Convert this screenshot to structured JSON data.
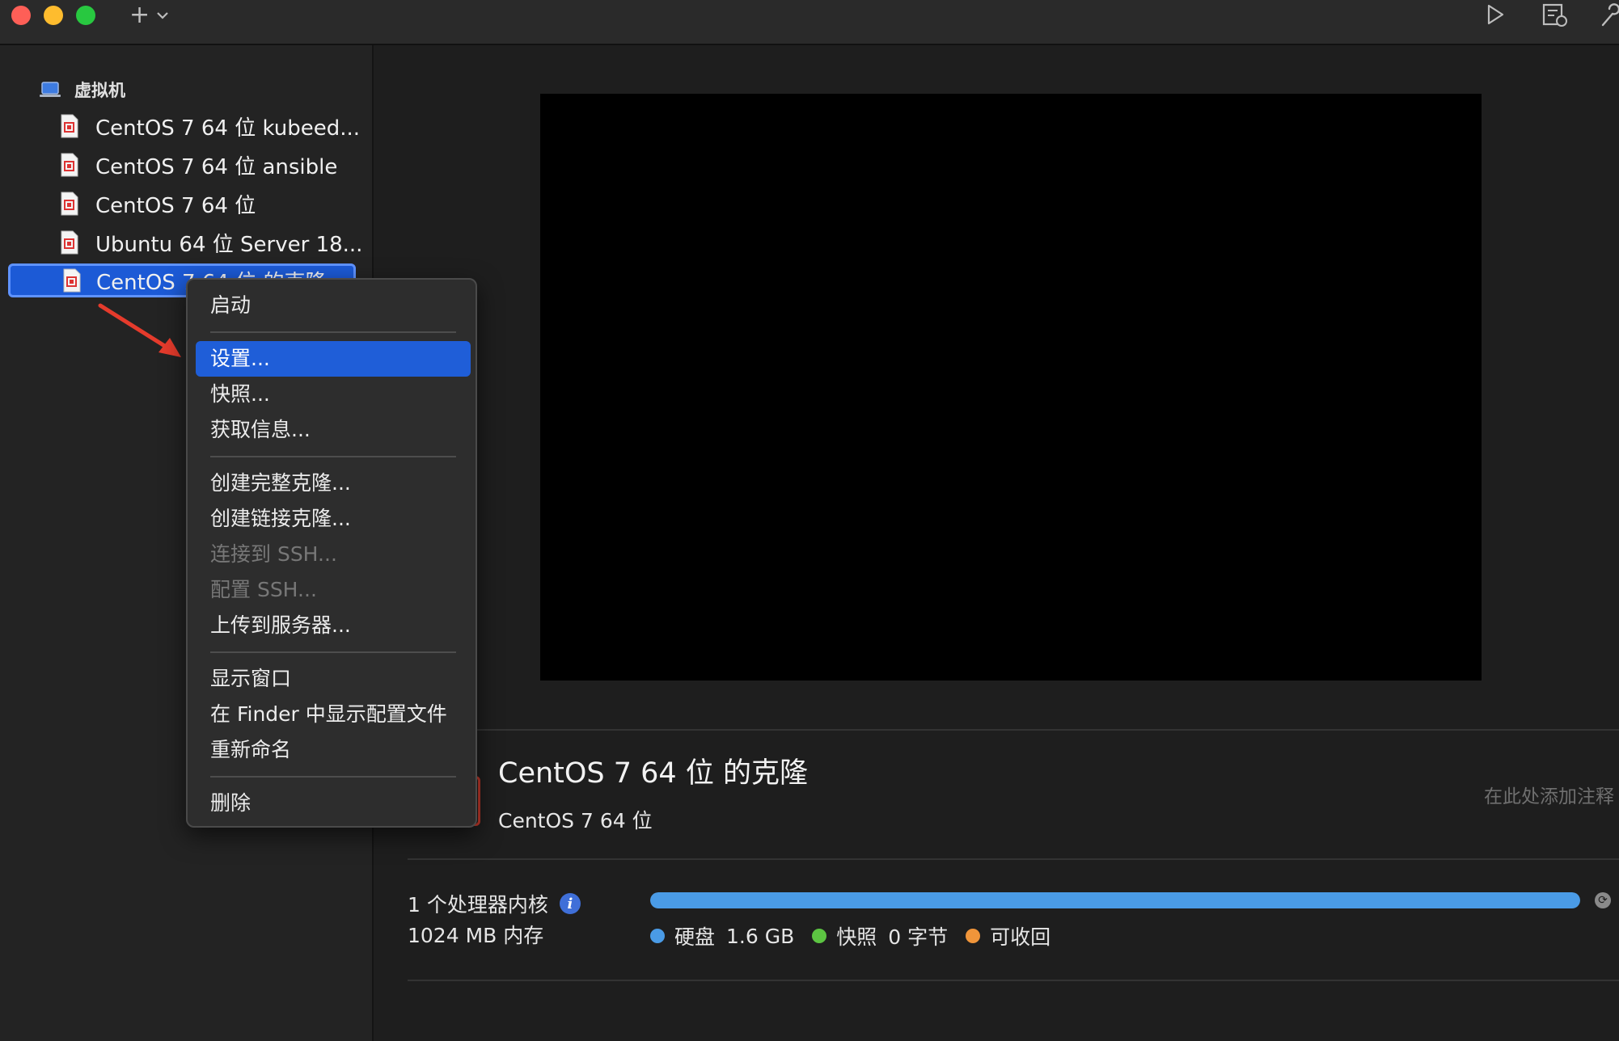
{
  "sidebar": {
    "group_label": "虚拟机",
    "items": [
      {
        "label": "CentOS 7 64 位 kubeed..."
      },
      {
        "label": "CentOS 7 64 位 ansible"
      },
      {
        "label": "CentOS 7 64 位"
      },
      {
        "label": "Ubuntu 64 位 Server 18..."
      },
      {
        "label": "CentOS 7 64 位 的克隆"
      }
    ]
  },
  "context_menu": {
    "items": [
      {
        "label": "启动"
      },
      {
        "label": "设置..."
      },
      {
        "label": "快照..."
      },
      {
        "label": "获取信息..."
      },
      {
        "label": "创建完整克隆..."
      },
      {
        "label": "创建链接克隆..."
      },
      {
        "label": "连接到 SSH..."
      },
      {
        "label": "配置 SSH..."
      },
      {
        "label": "上传到服务器..."
      },
      {
        "label": "显示窗口"
      },
      {
        "label": "在 Finder 中显示配置文件"
      },
      {
        "label": "重新命名"
      },
      {
        "label": "删除"
      }
    ]
  },
  "details": {
    "title": "CentOS 7 64 位 的克隆",
    "os": "CentOS 7 64 位",
    "notes_placeholder": "在此处添加注释",
    "cpu": "1 个处理器内核",
    "memory": "1024 MB 内存",
    "storage_used_fraction": 1.0,
    "legend": {
      "disk_label": "硬盘",
      "disk_value": "1.6 GB",
      "snapshot_label": "快照",
      "snapshot_value": "0 字节",
      "reclaimable_label": "可收回"
    }
  },
  "colors": {
    "selection": "#1c5ad6",
    "menu_highlight": "#1f5ed8",
    "disk": "#4a9be6",
    "snapshot": "#5cc442",
    "reclaimable": "#f0953a"
  }
}
